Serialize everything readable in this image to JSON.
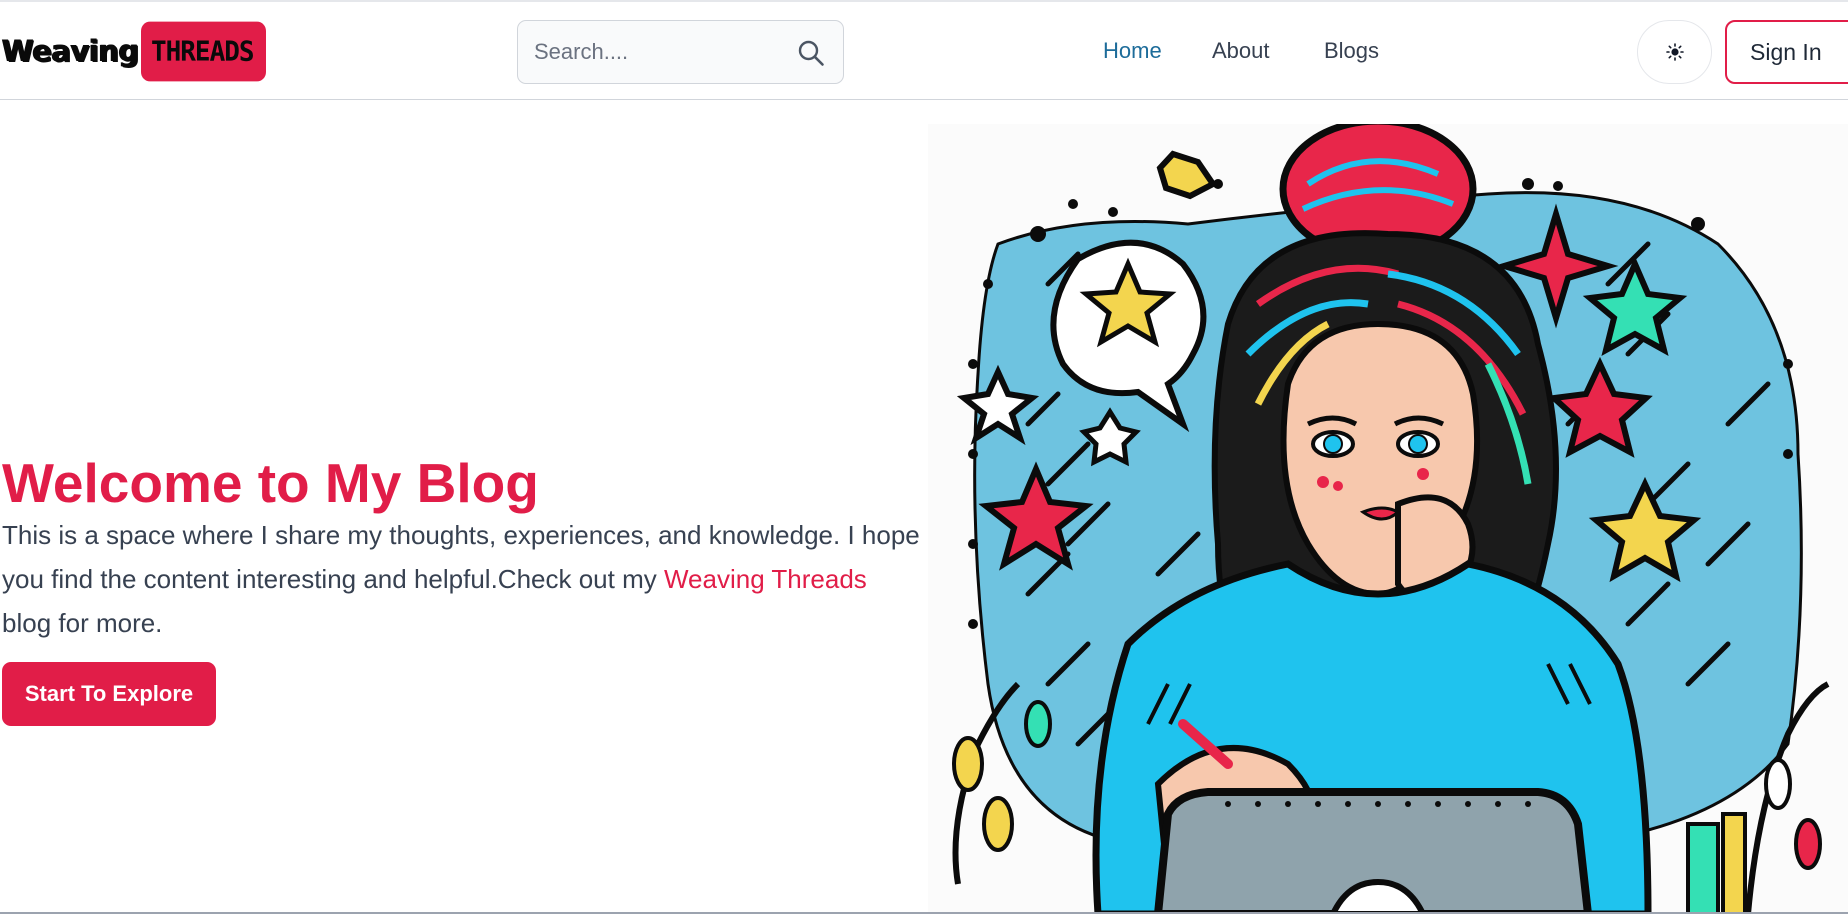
{
  "header": {
    "logo": {
      "word": "Weaving",
      "pill": "THREADS"
    },
    "search": {
      "placeholder": "Search...."
    },
    "nav": [
      {
        "label": "Home",
        "active": true
      },
      {
        "label": "About",
        "active": false
      },
      {
        "label": "Blogs",
        "active": false
      }
    ],
    "theme_toggle": {
      "icon": "sun-icon",
      "glyph": "☼"
    },
    "sign_in_label": "Sign In"
  },
  "hero": {
    "title": "Welcome to My Blog",
    "text_before": "This is a space where I share my thoughts, experiences, and knowledge. I hope you find the content interesting and helpful.Check out my ",
    "link_text": "Weaving Threads",
    "text_after": " blog for more.",
    "cta_label": "Start To Explore",
    "image": {
      "icon": "girl-studying-illustration"
    }
  },
  "colors": {
    "accent": "#e11d48",
    "nav_active": "#1d6c9a",
    "text": "#374151",
    "illustration_sky": "#6ec3e0",
    "illustration_shirt": "#1fc3ee",
    "illustration_star_yellow": "#f3d54e",
    "illustration_star_red": "#e8264a",
    "illustration_star_teal": "#34e0b4"
  }
}
